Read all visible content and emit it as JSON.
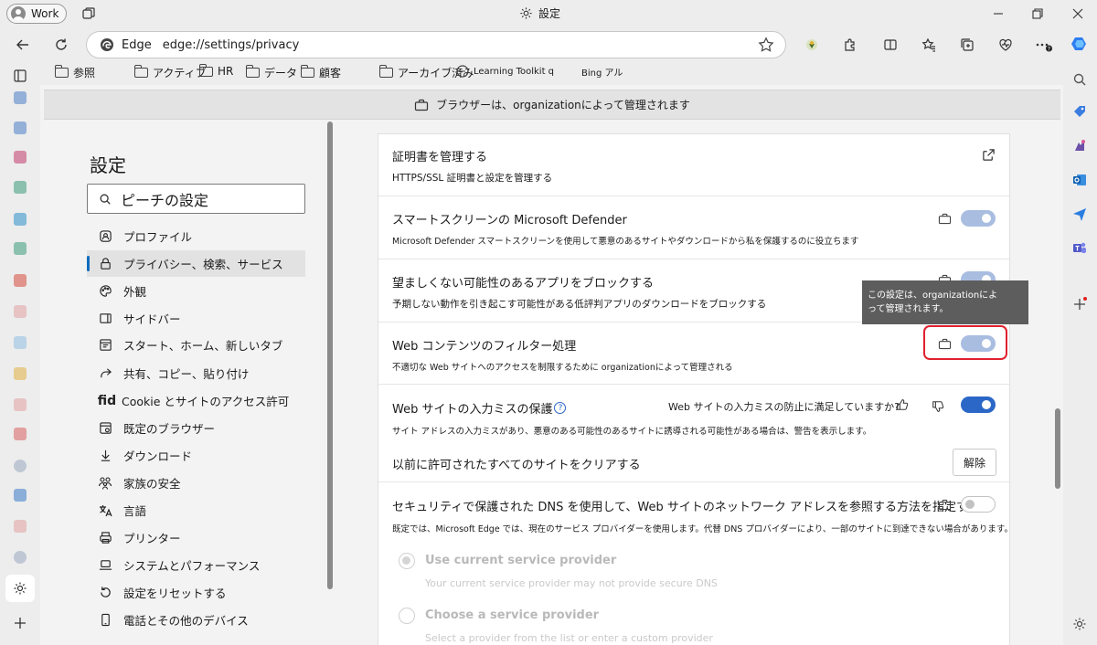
{
  "titlebar": {
    "profile_label": "Work",
    "window_title": "設定"
  },
  "navrow": {
    "edge_label": "Edge",
    "url": "edge://settings/privacy"
  },
  "favorites": [
    {
      "label": "参照",
      "icon": "folder-icon"
    },
    {
      "label": "アクティブ",
      "icon": "folder-icon"
    },
    {
      "label": "HR",
      "icon": "folder-icon"
    },
    {
      "label": "データ",
      "icon": "folder-icon"
    },
    {
      "label": "顧客",
      "icon": "folder-icon"
    },
    {
      "label": "アーカイブ済み",
      "icon": "folder-icon"
    },
    {
      "label": "Learning Toolkit q",
      "icon": "page-icon"
    },
    {
      "label": "Bing アル",
      "icon": "page-icon"
    }
  ],
  "banner": {
    "text": "ブラウザーは、organizationによって管理されます"
  },
  "settings_nav": {
    "title": "設定",
    "search_placeholder": "ピーチの設定",
    "items": [
      {
        "label": "プロファイル",
        "icon": "profile-icon"
      },
      {
        "label": "プライバシー、検索、サービス",
        "icon": "lock-icon"
      },
      {
        "label": "外観",
        "icon": "palette-icon"
      },
      {
        "label": "サイドバー",
        "icon": "sidebar-icon"
      },
      {
        "label": "スタート、ホーム、新しいタブ",
        "icon": "home-icon"
      },
      {
        "label": "共有、コピー、貼り付け",
        "icon": "share-icon"
      },
      {
        "label": "Cookie とサイトのアクセス許可",
        "icon": "cookie-icon",
        "glyph": "fid"
      },
      {
        "label": "既定のブラウザー",
        "icon": "browser-icon"
      },
      {
        "label": "ダウンロード",
        "icon": "download-icon"
      },
      {
        "label": "家族の安全",
        "icon": "family-icon"
      },
      {
        "label": "言語",
        "icon": "language-icon"
      },
      {
        "label": "プリンター",
        "icon": "printer-icon"
      },
      {
        "label": "システムとパフォーマンス",
        "icon": "laptop-icon"
      },
      {
        "label": "設定をリセットする",
        "icon": "reset-icon"
      },
      {
        "label": "電話とその他のデバイス",
        "icon": "phone-icon"
      }
    ]
  },
  "content": {
    "cert": {
      "title": "証明書を管理する",
      "desc": "HTTPS/SSL 証明書と設定を管理する"
    },
    "smartscreen": {
      "title": "スマートスクリーンの Microsoft Defender",
      "desc": "Microsoft Defender スマートスクリーンを使用して悪意のあるサイトやダウンロードから私を保護するのに役立ちます"
    },
    "pua": {
      "title": "望ましくない可能性のあるアプリをブロックする",
      "desc": "予期しない動作を引き起こす可能性がある低評判アプリのダウンロードをブロックする"
    },
    "filter": {
      "title": "Web コンテンツのフィルター処理",
      "desc": "不適切な Web サイトへのアクセスを制限するために organizationによって管理される"
    },
    "typo": {
      "title": "Web サイトの入力ミスの保護",
      "help_glyph": "?",
      "feedback_question": "Web サイトの入力ミスの防止に満足していますか?",
      "desc": "サイト アドレスの入力ミスがあり、悪意のある可能性のあるサイトに誘導される可能性がある場合は、警告を表示します。"
    },
    "clear": {
      "title": "以前に許可されたすべてのサイトをクリアする",
      "button": "解除"
    },
    "dns": {
      "title": "セキュリティで保護された DNS を使用して、Web サイトのネットワーク アドレスを参照する方法を指定する",
      "desc": "既定では、Microsoft Edge では、現在のサービス プロバイダーを使用します。代替 DNS プロバイダーにより、一部のサイトに到達できない場合があります。"
    },
    "dns_options": [
      {
        "label": "Use current service provider",
        "sub": "Your current service provider may not provide secure DNS"
      },
      {
        "label": "Choose a service provider",
        "sub": "Select a provider from the list or enter a custom provider"
      }
    ]
  },
  "tooltip": {
    "line1": "この設定は、organizationによ",
    "line2": "って管理されます。"
  },
  "colors": {
    "accent": "#2b67c6",
    "toggle_disabled": "#a9bde0",
    "highlight": "#e0202e",
    "tooltip_bg": "#5d5d5d"
  }
}
